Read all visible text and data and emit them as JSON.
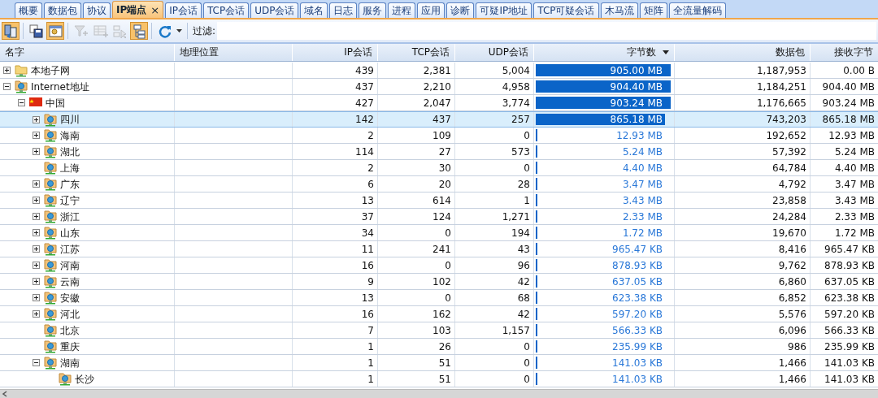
{
  "tabs": [
    {
      "label": "概要",
      "selected": false
    },
    {
      "label": "数据包",
      "selected": false
    },
    {
      "label": "协议",
      "selected": false
    },
    {
      "label": "IP端点",
      "selected": true,
      "close": "×"
    },
    {
      "label": "IP会话",
      "selected": false
    },
    {
      "label": "TCP会话",
      "selected": false
    },
    {
      "label": "UDP会话",
      "selected": false
    },
    {
      "label": "域名",
      "selected": false
    },
    {
      "label": "日志",
      "selected": false
    },
    {
      "label": "服务",
      "selected": false
    },
    {
      "label": "进程",
      "selected": false
    },
    {
      "label": "应用",
      "selected": false
    },
    {
      "label": "诊断",
      "selected": false
    },
    {
      "label": "可疑IP地址",
      "selected": false
    },
    {
      "label": "TCP可疑会话",
      "selected": false
    },
    {
      "label": "木马流",
      "selected": false
    },
    {
      "label": "矩阵",
      "selected": false
    },
    {
      "label": "全流量解码",
      "selected": false
    }
  ],
  "toolbar": {
    "buttons": [
      {
        "kind": "export",
        "pressed": true,
        "disabled": false
      },
      {
        "kind": "save",
        "pressed": false,
        "disabled": false
      },
      {
        "kind": "locate",
        "pressed": true,
        "disabled": false
      },
      {
        "kind": "filter",
        "pressed": false,
        "disabled": true
      },
      {
        "kind": "table",
        "pressed": false,
        "disabled": true
      },
      {
        "kind": "pointer",
        "pressed": false,
        "disabled": true
      },
      {
        "kind": "tree",
        "pressed": true,
        "disabled": false
      },
      {
        "kind": "refresh",
        "pressed": false,
        "disabled": false
      }
    ],
    "filter_label": "过滤:"
  },
  "table": {
    "columns": [
      {
        "label": "名字",
        "sorted": false
      },
      {
        "label": "地理位置",
        "sorted": false
      },
      {
        "label": "IP会话",
        "sorted": false
      },
      {
        "label": "TCP会话",
        "sorted": false
      },
      {
        "label": "UDP会话",
        "sorted": false
      },
      {
        "label": "字节数",
        "sorted": true
      },
      {
        "label": "数据包",
        "sorted": false
      },
      {
        "label": "接收字节",
        "sorted": false
      }
    ],
    "rows": [
      {
        "name": "本地子网",
        "kind": "folder",
        "expanded": false,
        "selected": false,
        "ip_sessions": "439",
        "tcp_sessions": "2,381",
        "udp_sessions": "5,004",
        "bytes": "905.00 MB",
        "level": 1.0,
        "packets": "1,187,953",
        "received": "0.00 B"
      },
      {
        "name": "Internet地址",
        "kind": "network",
        "expanded": true,
        "selected": false,
        "ip_sessions": "437",
        "tcp_sessions": "2,210",
        "udp_sessions": "4,958",
        "bytes": "904.40 MB",
        "level": 0.999,
        "packets": "1,184,251",
        "received": "904.40 MB",
        "children": [
          {
            "name": "中国",
            "kind": "flag",
            "expanded": true,
            "selected": false,
            "ip_sessions": "427",
            "tcp_sessions": "2,047",
            "udp_sessions": "3,774",
            "bytes": "903.24 MB",
            "level": 0.998,
            "packets": "1,176,665",
            "received": "903.24 MB",
            "children": [
              {
                "name": "四川",
                "kind": "network",
                "expanded": false,
                "selected": true,
                "ip_sessions": "142",
                "tcp_sessions": "437",
                "udp_sessions": "257",
                "bytes": "865.18 MB",
                "level": 0.956,
                "packets": "743,203",
                "received": "865.18 MB"
              },
              {
                "name": "海南",
                "kind": "network",
                "expanded": false,
                "selected": false,
                "ip_sessions": "2",
                "tcp_sessions": "109",
                "udp_sessions": "0",
                "bytes": "12.93 MB",
                "level": 0.014,
                "packets": "192,652",
                "received": "12.93 MB"
              },
              {
                "name": "湖北",
                "kind": "network",
                "expanded": false,
                "selected": false,
                "ip_sessions": "114",
                "tcp_sessions": "27",
                "udp_sessions": "573",
                "bytes": "5.24 MB",
                "level": 0.006,
                "packets": "57,392",
                "received": "5.24 MB"
              },
              {
                "name": "上海",
                "kind": "network",
                "selected": false,
                "ip_sessions": "2",
                "tcp_sessions": "30",
                "udp_sessions": "0",
                "bytes": "4.40 MB",
                "level": 0.005,
                "packets": "64,784",
                "received": "4.40 MB"
              },
              {
                "name": "广东",
                "kind": "network",
                "expanded": false,
                "selected": false,
                "ip_sessions": "6",
                "tcp_sessions": "20",
                "udp_sessions": "28",
                "bytes": "3.47 MB",
                "level": 0.004,
                "packets": "4,792",
                "received": "3.47 MB"
              },
              {
                "name": "辽宁",
                "kind": "network",
                "expanded": false,
                "selected": false,
                "ip_sessions": "13",
                "tcp_sessions": "614",
                "udp_sessions": "1",
                "bytes": "3.43 MB",
                "level": 0.004,
                "packets": "23,858",
                "received": "3.43 MB"
              },
              {
                "name": "浙江",
                "kind": "network",
                "expanded": false,
                "selected": false,
                "ip_sessions": "37",
                "tcp_sessions": "124",
                "udp_sessions": "1,271",
                "bytes": "2.33 MB",
                "level": 0.003,
                "packets": "24,284",
                "received": "2.33 MB"
              },
              {
                "name": "山东",
                "kind": "network",
                "expanded": false,
                "selected": false,
                "ip_sessions": "34",
                "tcp_sessions": "0",
                "udp_sessions": "194",
                "bytes": "1.72 MB",
                "level": 0.002,
                "packets": "19,670",
                "received": "1.72 MB"
              },
              {
                "name": "江苏",
                "kind": "network",
                "expanded": false,
                "selected": false,
                "ip_sessions": "11",
                "tcp_sessions": "241",
                "udp_sessions": "43",
                "bytes": "965.47 KB",
                "level": 0.001,
                "packets": "8,416",
                "received": "965.47 KB"
              },
              {
                "name": "河南",
                "kind": "network",
                "expanded": false,
                "selected": false,
                "ip_sessions": "16",
                "tcp_sessions": "0",
                "udp_sessions": "96",
                "bytes": "878.93 KB",
                "level": 0.001,
                "packets": "9,762",
                "received": "878.93 KB"
              },
              {
                "name": "云南",
                "kind": "network",
                "expanded": false,
                "selected": false,
                "ip_sessions": "9",
                "tcp_sessions": "102",
                "udp_sessions": "42",
                "bytes": "637.05 KB",
                "level": 0.001,
                "packets": "6,860",
                "received": "637.05 KB"
              },
              {
                "name": "安徽",
                "kind": "network",
                "expanded": false,
                "selected": false,
                "ip_sessions": "13",
                "tcp_sessions": "0",
                "udp_sessions": "68",
                "bytes": "623.38 KB",
                "level": 0.001,
                "packets": "6,852",
                "received": "623.38 KB"
              },
              {
                "name": "河北",
                "kind": "network",
                "expanded": false,
                "selected": false,
                "ip_sessions": "16",
                "tcp_sessions": "162",
                "udp_sessions": "42",
                "bytes": "597.20 KB",
                "level": 0.001,
                "packets": "5,576",
                "received": "597.20 KB"
              },
              {
                "name": "北京",
                "kind": "network",
                "selected": false,
                "ip_sessions": "7",
                "tcp_sessions": "103",
                "udp_sessions": "1,157",
                "bytes": "566.33 KB",
                "level": 0.001,
                "packets": "6,096",
                "received": "566.33 KB"
              },
              {
                "name": "重庆",
                "kind": "network",
                "selected": false,
                "ip_sessions": "1",
                "tcp_sessions": "26",
                "udp_sessions": "0",
                "bytes": "235.99 KB",
                "level": 0.0003,
                "packets": "986",
                "received": "235.99 KB"
              },
              {
                "name": "湖南",
                "kind": "network",
                "expanded": true,
                "selected": false,
                "ip_sessions": "1",
                "tcp_sessions": "51",
                "udp_sessions": "0",
                "bytes": "141.03 KB",
                "level": 0.0002,
                "packets": "1,466",
                "received": "141.03 KB",
                "children": [
                  {
                    "name": "长沙",
                    "kind": "network",
                    "selected": false,
                    "ip_sessions": "1",
                    "tcp_sessions": "51",
                    "udp_sessions": "0",
                    "bytes": "141.03 KB",
                    "level": 0.0002,
                    "packets": "1,466",
                    "received": "141.03 KB"
                  }
                ]
              }
            ]
          }
        ]
      }
    ]
  }
}
